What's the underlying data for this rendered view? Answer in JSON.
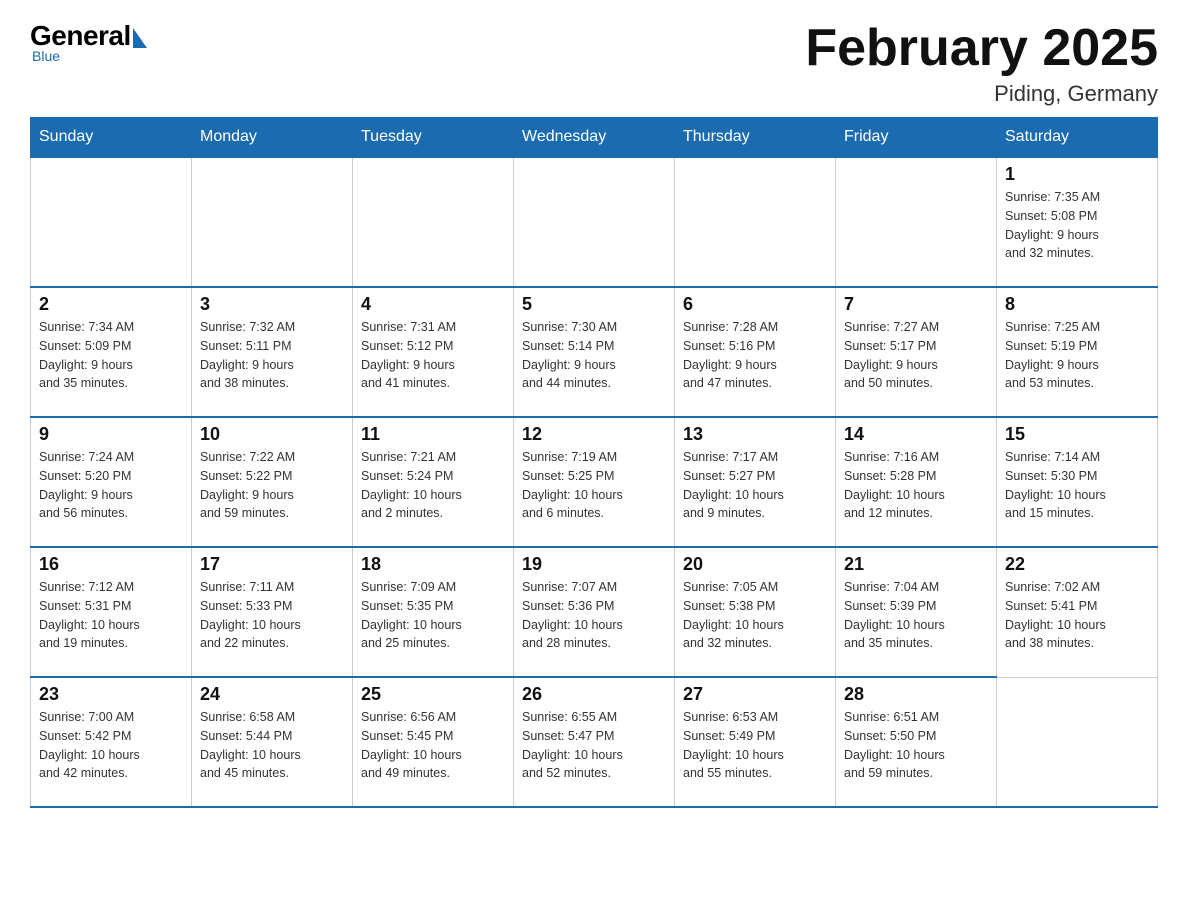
{
  "logo": {
    "general": "General",
    "blue": "Blue",
    "subtitle": "Blue"
  },
  "header": {
    "title": "February 2025",
    "location": "Piding, Germany"
  },
  "days_of_week": [
    "Sunday",
    "Monday",
    "Tuesday",
    "Wednesday",
    "Thursday",
    "Friday",
    "Saturday"
  ],
  "weeks": [
    {
      "days": [
        {
          "number": "",
          "info": ""
        },
        {
          "number": "",
          "info": ""
        },
        {
          "number": "",
          "info": ""
        },
        {
          "number": "",
          "info": ""
        },
        {
          "number": "",
          "info": ""
        },
        {
          "number": "",
          "info": ""
        },
        {
          "number": "1",
          "info": "Sunrise: 7:35 AM\nSunset: 5:08 PM\nDaylight: 9 hours\nand 32 minutes."
        }
      ]
    },
    {
      "days": [
        {
          "number": "2",
          "info": "Sunrise: 7:34 AM\nSunset: 5:09 PM\nDaylight: 9 hours\nand 35 minutes."
        },
        {
          "number": "3",
          "info": "Sunrise: 7:32 AM\nSunset: 5:11 PM\nDaylight: 9 hours\nand 38 minutes."
        },
        {
          "number": "4",
          "info": "Sunrise: 7:31 AM\nSunset: 5:12 PM\nDaylight: 9 hours\nand 41 minutes."
        },
        {
          "number": "5",
          "info": "Sunrise: 7:30 AM\nSunset: 5:14 PM\nDaylight: 9 hours\nand 44 minutes."
        },
        {
          "number": "6",
          "info": "Sunrise: 7:28 AM\nSunset: 5:16 PM\nDaylight: 9 hours\nand 47 minutes."
        },
        {
          "number": "7",
          "info": "Sunrise: 7:27 AM\nSunset: 5:17 PM\nDaylight: 9 hours\nand 50 minutes."
        },
        {
          "number": "8",
          "info": "Sunrise: 7:25 AM\nSunset: 5:19 PM\nDaylight: 9 hours\nand 53 minutes."
        }
      ]
    },
    {
      "days": [
        {
          "number": "9",
          "info": "Sunrise: 7:24 AM\nSunset: 5:20 PM\nDaylight: 9 hours\nand 56 minutes."
        },
        {
          "number": "10",
          "info": "Sunrise: 7:22 AM\nSunset: 5:22 PM\nDaylight: 9 hours\nand 59 minutes."
        },
        {
          "number": "11",
          "info": "Sunrise: 7:21 AM\nSunset: 5:24 PM\nDaylight: 10 hours\nand 2 minutes."
        },
        {
          "number": "12",
          "info": "Sunrise: 7:19 AM\nSunset: 5:25 PM\nDaylight: 10 hours\nand 6 minutes."
        },
        {
          "number": "13",
          "info": "Sunrise: 7:17 AM\nSunset: 5:27 PM\nDaylight: 10 hours\nand 9 minutes."
        },
        {
          "number": "14",
          "info": "Sunrise: 7:16 AM\nSunset: 5:28 PM\nDaylight: 10 hours\nand 12 minutes."
        },
        {
          "number": "15",
          "info": "Sunrise: 7:14 AM\nSunset: 5:30 PM\nDaylight: 10 hours\nand 15 minutes."
        }
      ]
    },
    {
      "days": [
        {
          "number": "16",
          "info": "Sunrise: 7:12 AM\nSunset: 5:31 PM\nDaylight: 10 hours\nand 19 minutes."
        },
        {
          "number": "17",
          "info": "Sunrise: 7:11 AM\nSunset: 5:33 PM\nDaylight: 10 hours\nand 22 minutes."
        },
        {
          "number": "18",
          "info": "Sunrise: 7:09 AM\nSunset: 5:35 PM\nDaylight: 10 hours\nand 25 minutes."
        },
        {
          "number": "19",
          "info": "Sunrise: 7:07 AM\nSunset: 5:36 PM\nDaylight: 10 hours\nand 28 minutes."
        },
        {
          "number": "20",
          "info": "Sunrise: 7:05 AM\nSunset: 5:38 PM\nDaylight: 10 hours\nand 32 minutes."
        },
        {
          "number": "21",
          "info": "Sunrise: 7:04 AM\nSunset: 5:39 PM\nDaylight: 10 hours\nand 35 minutes."
        },
        {
          "number": "22",
          "info": "Sunrise: 7:02 AM\nSunset: 5:41 PM\nDaylight: 10 hours\nand 38 minutes."
        }
      ]
    },
    {
      "days": [
        {
          "number": "23",
          "info": "Sunrise: 7:00 AM\nSunset: 5:42 PM\nDaylight: 10 hours\nand 42 minutes."
        },
        {
          "number": "24",
          "info": "Sunrise: 6:58 AM\nSunset: 5:44 PM\nDaylight: 10 hours\nand 45 minutes."
        },
        {
          "number": "25",
          "info": "Sunrise: 6:56 AM\nSunset: 5:45 PM\nDaylight: 10 hours\nand 49 minutes."
        },
        {
          "number": "26",
          "info": "Sunrise: 6:55 AM\nSunset: 5:47 PM\nDaylight: 10 hours\nand 52 minutes."
        },
        {
          "number": "27",
          "info": "Sunrise: 6:53 AM\nSunset: 5:49 PM\nDaylight: 10 hours\nand 55 minutes."
        },
        {
          "number": "28",
          "info": "Sunrise: 6:51 AM\nSunset: 5:50 PM\nDaylight: 10 hours\nand 59 minutes."
        },
        {
          "number": "",
          "info": ""
        }
      ]
    }
  ]
}
